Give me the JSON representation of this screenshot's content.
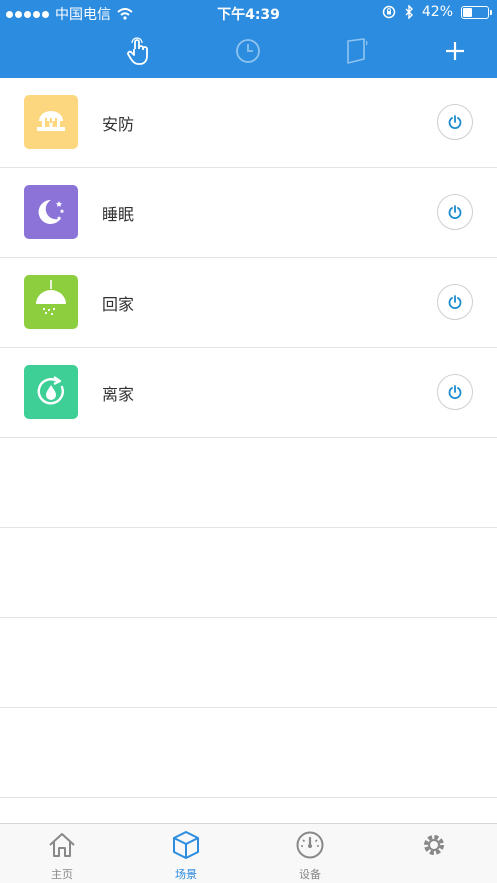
{
  "status_bar": {
    "carrier": "中国电信",
    "time": "下午4:39",
    "battery_percent": "42%",
    "battery_level": 0.42
  },
  "toolbar": {
    "buttons": [
      "hand-pointer-icon",
      "clock-icon",
      "flag-icon",
      "plus-icon"
    ]
  },
  "scenes": [
    {
      "label": "安防",
      "icon": "security-icon",
      "color": "#fcd77f"
    },
    {
      "label": "睡眠",
      "icon": "moon-stars-icon",
      "color": "#8b73d8"
    },
    {
      "label": "回家",
      "icon": "lamp-icon",
      "color": "#8dce3e"
    },
    {
      "label": "离家",
      "icon": "water-drop-icon",
      "color": "#3dcf95"
    }
  ],
  "tabbar": {
    "tabs": [
      {
        "label": "主页",
        "icon": "home-icon",
        "active": false
      },
      {
        "label": "场景",
        "icon": "cube-icon",
        "active": true
      },
      {
        "label": "设备",
        "icon": "gauge-icon",
        "active": false
      },
      {
        "label": "",
        "icon": "gear-icon",
        "active": false
      }
    ]
  },
  "colors": {
    "header_bg": "#2b8ce0",
    "accent": "#2b8ce0",
    "power_icon": "#1a8bd0"
  }
}
